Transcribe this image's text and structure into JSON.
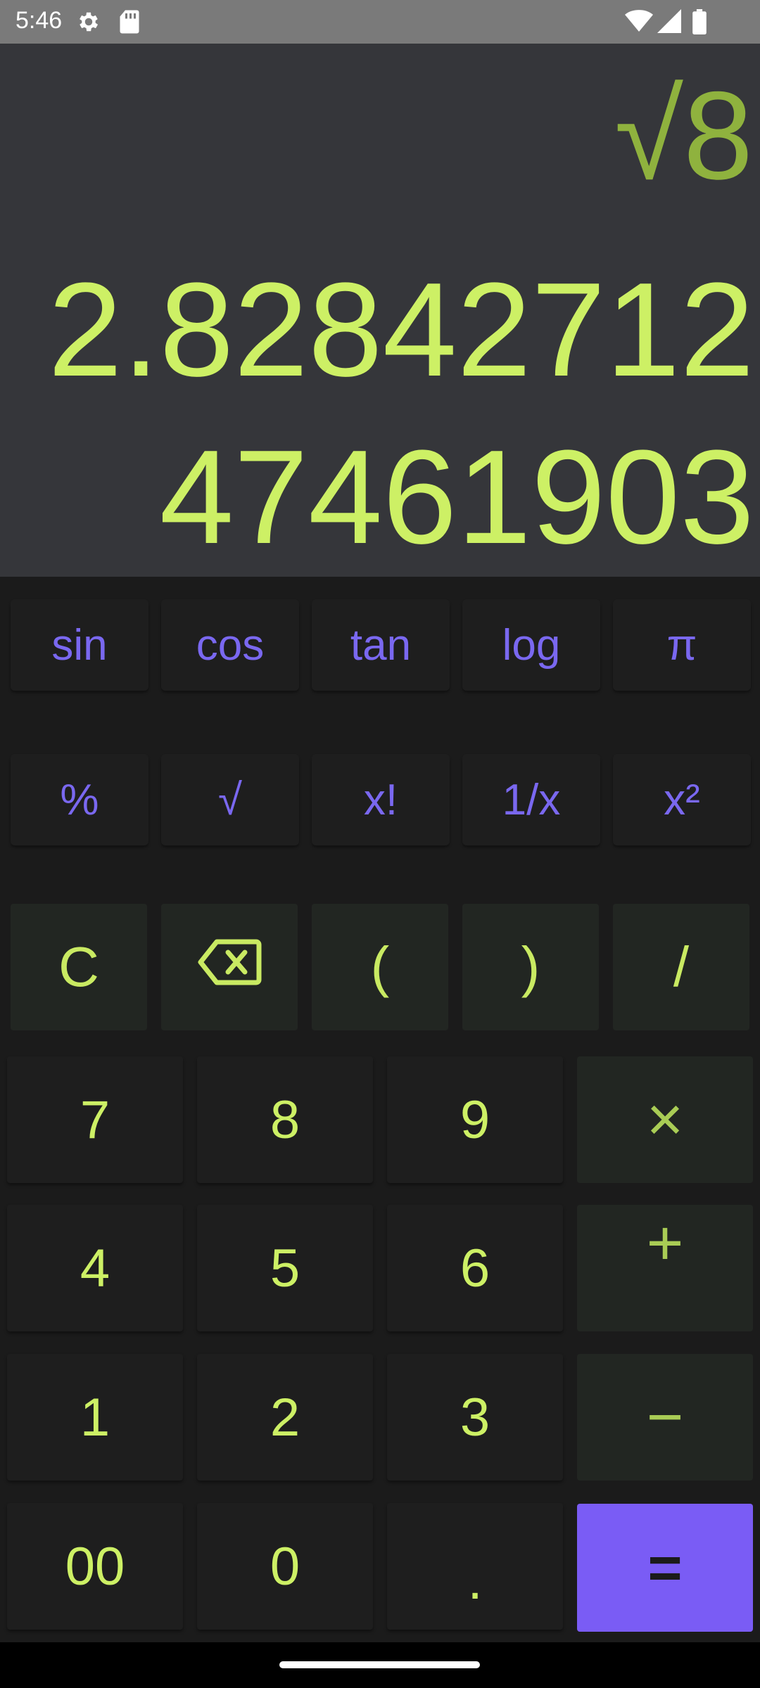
{
  "status_bar": {
    "time": "5:46",
    "icons": [
      "gear-icon",
      "sd-card-icon",
      "wifi-icon",
      "cell-signal-icon",
      "battery-icon"
    ]
  },
  "display": {
    "expression": "√8",
    "result": "2.8284271247461903"
  },
  "scientific_row_1": [
    "sin",
    "cos",
    "tan",
    "log",
    "π"
  ],
  "scientific_row_2": [
    "%",
    "√",
    "x!",
    "1/x",
    "x²"
  ],
  "operator_row": {
    "clear": "C",
    "backspace_icon": "backspace-icon",
    "open_paren": "(",
    "close_paren": ")",
    "divide": "/"
  },
  "digits": {
    "d7": "7",
    "d8": "8",
    "d9": "9",
    "d4": "4",
    "d5": "5",
    "d6": "6",
    "d1": "1",
    "d2": "2",
    "d3": "3",
    "d00": "00",
    "d0": "0",
    "dot": "."
  },
  "operators": {
    "multiply": "×",
    "add": "+",
    "subtract": "−",
    "equals": "="
  },
  "colors": {
    "display_bg": "#35363a",
    "result_text": "#cdf065",
    "expression_text": "#8fb23e",
    "scientific_text": "#7a68f0",
    "equals_bg": "#7a5cf5"
  }
}
